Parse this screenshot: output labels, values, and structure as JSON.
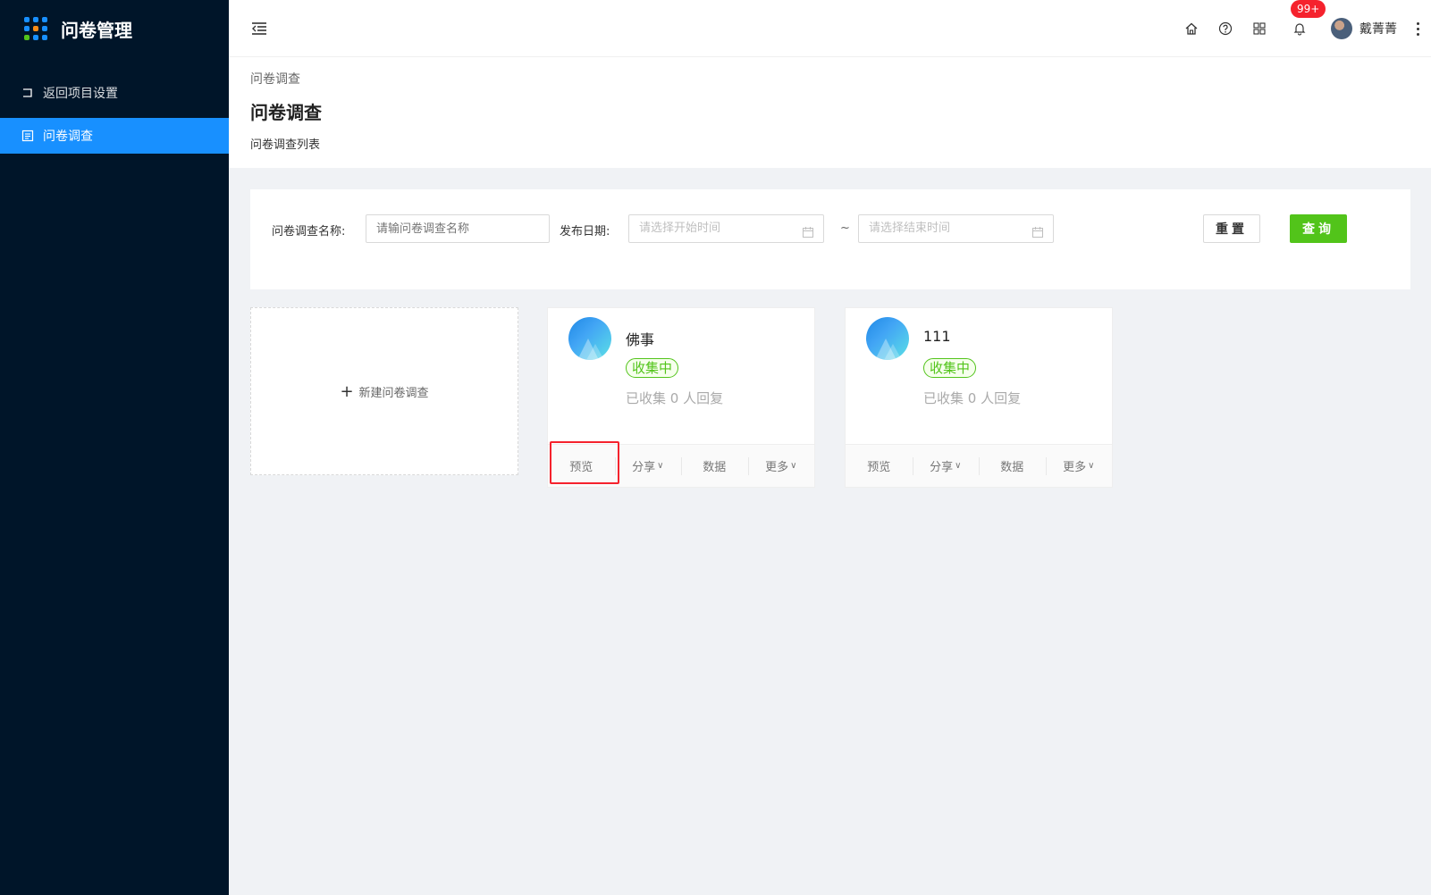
{
  "sidebar": {
    "title": "问卷管理",
    "items": [
      {
        "label": "返回项目设置"
      },
      {
        "label": "问卷调查"
      }
    ]
  },
  "header": {
    "badge": "99+",
    "username": "戴菁菁"
  },
  "page": {
    "breadcrumb": "问卷调查",
    "title": "问卷调查",
    "description": "问卷调查列表"
  },
  "search": {
    "name_label": "问卷调查名称:",
    "name_placeholder": "请输问卷调查名称",
    "date_label": "发布日期:",
    "start_placeholder": "请选择开始时间",
    "end_placeholder": "请选择结束时间",
    "separator": "~",
    "reset_label": "重置",
    "query_label": "查询"
  },
  "new_card": {
    "plus": "+",
    "label": "新建问卷调查"
  },
  "surveys": [
    {
      "name": "佛事",
      "status": "收集中",
      "collected": "已收集 0 人回复"
    },
    {
      "name": "111",
      "status": "收集中",
      "collected": "已收集 0 人回复"
    }
  ],
  "actions": {
    "preview": "预览",
    "share": "分享",
    "data": "数据",
    "more": "更多",
    "caret": "∨"
  },
  "colors": {
    "sidebar_bg": "#001529",
    "primary": "#1890ff",
    "success": "#52c41a",
    "danger": "#f5222d"
  }
}
